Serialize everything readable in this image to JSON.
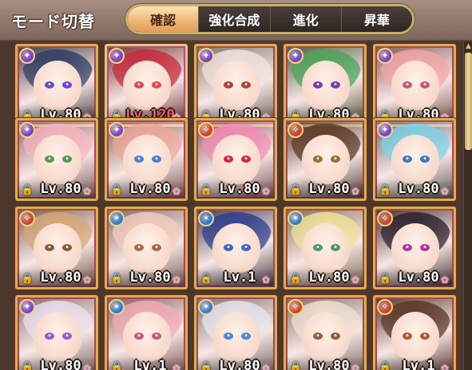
{
  "header": {
    "mode_title": "モード切替",
    "tabs": [
      {
        "label": "確認",
        "active": true
      },
      {
        "label": "強化合成",
        "active": false
      },
      {
        "label": "進化",
        "active": false
      },
      {
        "label": "昇華",
        "active": false
      }
    ]
  },
  "cards": [
    {
      "level": "Lv.80",
      "element": "dark",
      "hair": "#2e3b63",
      "eye": "#6a4bd1"
    },
    {
      "level": "Lv.120",
      "element": "dark",
      "hair": "#c8283b",
      "eye": "#e4484f",
      "max": true
    },
    {
      "level": "Lv.80",
      "element": "dark",
      "hair": "#efe6df",
      "eye": "#b24436"
    },
    {
      "level": "Lv.80",
      "element": "dark",
      "hair": "#4aa45a",
      "eye": "#7b3fa8"
    },
    {
      "level": "Lv.80",
      "element": "dark",
      "hair": "#f3a6a6",
      "eye": "#c45b7a"
    },
    {
      "level": "Lv.80",
      "element": "dark",
      "hair": "#f6b6bf",
      "eye": "#5a9a4a"
    },
    {
      "level": "Lv.80",
      "element": "dark",
      "hair": "#f0a89a",
      "eye": "#4e7fd6"
    },
    {
      "level": "Lv.80",
      "element": "fire",
      "hair": "#f58db6",
      "eye": "#d42a3c"
    },
    {
      "level": "Lv.80",
      "element": "fire",
      "hair": "#5b3623",
      "eye": "#a46a37"
    },
    {
      "level": "Lv.80",
      "element": "dark",
      "hair": "#7fd1e8",
      "eye": "#3e79c8"
    },
    {
      "level": "Lv.80",
      "element": "fire",
      "hair": "#d7a87a",
      "eye": "#8a5b3a"
    },
    {
      "level": "Lv.80",
      "element": "water",
      "hair": "#f4cdbe",
      "eye": "#a86b4a"
    },
    {
      "level": "Lv.1",
      "element": "water",
      "hair": "#2c3d8e",
      "eye": "#3f67c7"
    },
    {
      "level": "Lv.80",
      "element": "water",
      "hair": "#f1e39a",
      "eye": "#4b9a6b"
    },
    {
      "level": "Lv.80",
      "element": "fire",
      "hair": "#2a1f2a",
      "eye": "#b03aa3"
    },
    {
      "level": "Lv.80",
      "element": "dark",
      "hair": "#eee1f0",
      "eye": "#9a5ad1"
    },
    {
      "level": "Lv.1",
      "element": "water",
      "hair": "#f2aab7",
      "eye": "#c35c85"
    },
    {
      "level": "Lv.80",
      "element": "water",
      "hair": "#e7e7ef",
      "eye": "#4b8ad1"
    },
    {
      "level": "Lv.80",
      "element": "fire",
      "hair": "#efe2d4",
      "eye": "#9a5b3a"
    },
    {
      "level": "Lv.1",
      "element": "fire",
      "hair": "#5a3522",
      "eye": "#b35a38"
    }
  ],
  "element_colors": {
    "dark": "#7b3fd0",
    "fire": "#d2402a",
    "water": "#2f7dd3"
  },
  "element_glyphs": {
    "dark": "✦",
    "fire": "✧",
    "water": "✶"
  }
}
